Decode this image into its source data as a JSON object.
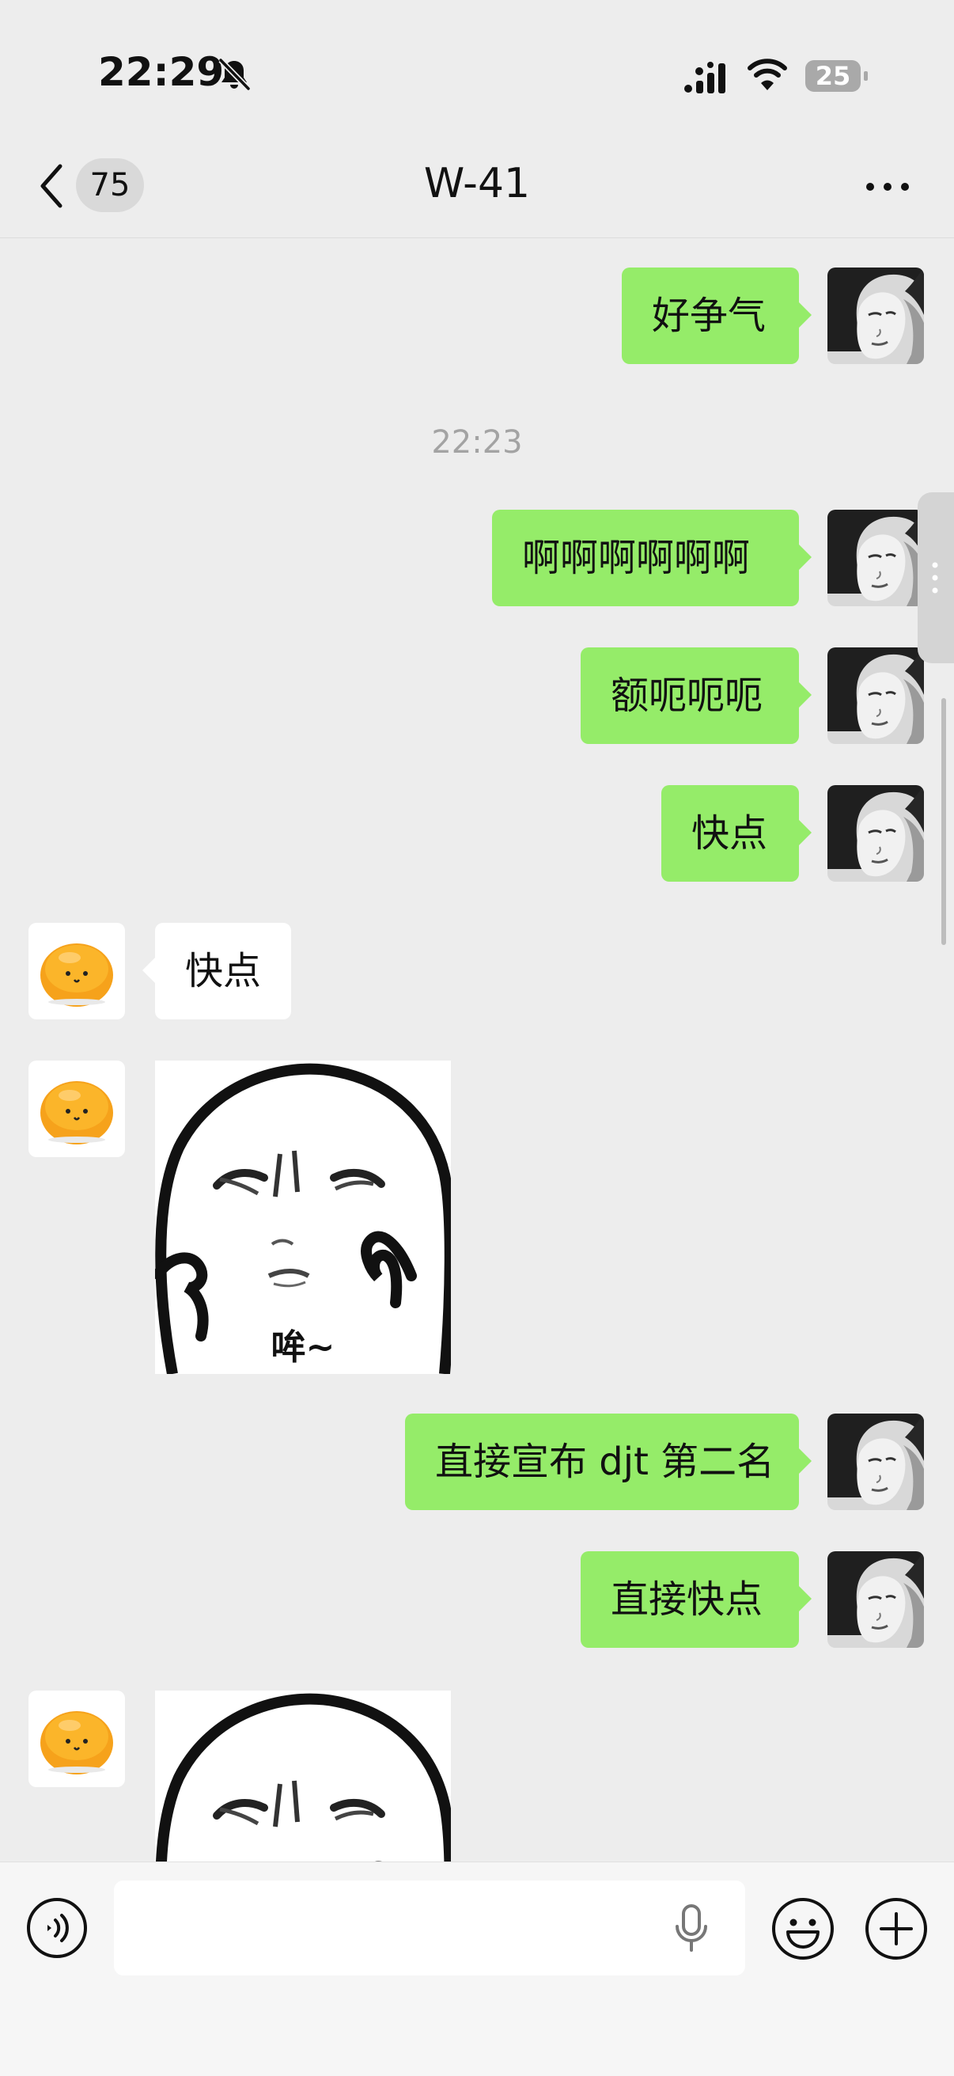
{
  "status_bar": {
    "time": "22:29",
    "battery_level": "25"
  },
  "header": {
    "unread_count": "75",
    "title": "W-41"
  },
  "chat": {
    "timestamp": "22:23",
    "messages": [
      {
        "side": "out",
        "text": "好争气"
      },
      {
        "side": "out",
        "text": "啊啊啊啊啊啊"
      },
      {
        "side": "out",
        "text": "额呃呃呃"
      },
      {
        "side": "out",
        "text": "快点"
      },
      {
        "side": "in",
        "text": "快点"
      },
      {
        "side": "in",
        "type": "sticker",
        "caption": "哞~"
      },
      {
        "side": "out",
        "text": "直接宣布 djt 第二名"
      },
      {
        "side": "out",
        "text": "直接快点"
      },
      {
        "side": "in",
        "type": "sticker"
      }
    ]
  },
  "input_bar": {
    "value": "",
    "placeholder": ""
  },
  "colors": {
    "bubble_out": "#95ec69",
    "bubble_in": "#ffffff",
    "background": "#ededed"
  },
  "icons": [
    "bell-off-icon",
    "signal-icon",
    "wifi-icon",
    "battery-icon",
    "back-icon",
    "more-icon",
    "voice-icon",
    "mic-icon",
    "emoji-icon",
    "plus-icon"
  ]
}
